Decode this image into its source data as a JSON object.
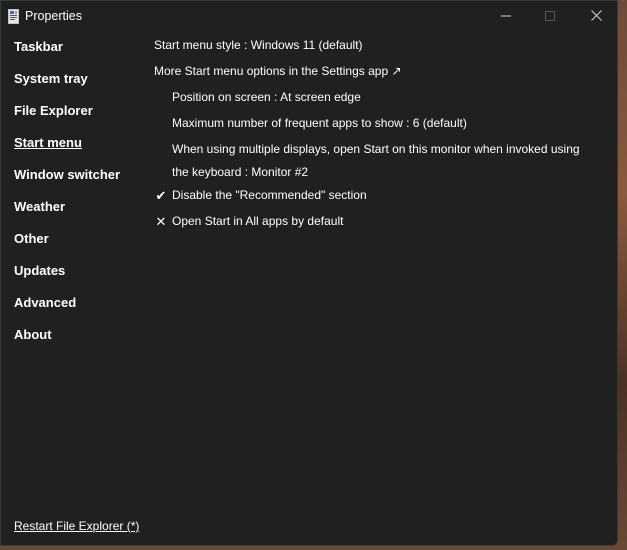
{
  "window": {
    "title": "Properties",
    "colors": {
      "background": "#202020",
      "text": "#ffffff",
      "controls": "#cfcfcf"
    }
  },
  "sidebar": {
    "items": [
      {
        "label": "Taskbar",
        "active": false
      },
      {
        "label": "System tray",
        "active": false
      },
      {
        "label": "File Explorer",
        "active": false
      },
      {
        "label": "Start menu",
        "active": true
      },
      {
        "label": "Window switcher",
        "active": false
      },
      {
        "label": "Weather",
        "active": false
      },
      {
        "label": "Other",
        "active": false
      },
      {
        "label": "Updates",
        "active": false
      },
      {
        "label": "Advanced",
        "active": false
      },
      {
        "label": "About",
        "active": false
      }
    ],
    "restart_link": "Restart File Explorer (*)"
  },
  "settings": {
    "start_menu_style": "Start menu style : Windows 11 (default)",
    "more_options_link": "More Start menu options in the Settings app ↗",
    "position_on_screen": "Position on screen : At screen edge",
    "max_frequent_apps": "Maximum number of frequent apps to show : 6 (default)",
    "multi_display": "When using multiple displays, open Start on this monitor when invoked using the keyboard : Monitor #2",
    "disable_recommended": {
      "label": "Disable the \"Recommended\" section",
      "mark": "✔",
      "checked": true
    },
    "open_all_apps": {
      "label": "Open Start in All apps by default",
      "mark": "✕",
      "checked": false
    }
  },
  "icons": {
    "app": "app-window-icon",
    "minimize": "minimize-icon",
    "maximize": "maximize-icon",
    "close": "close-icon"
  }
}
